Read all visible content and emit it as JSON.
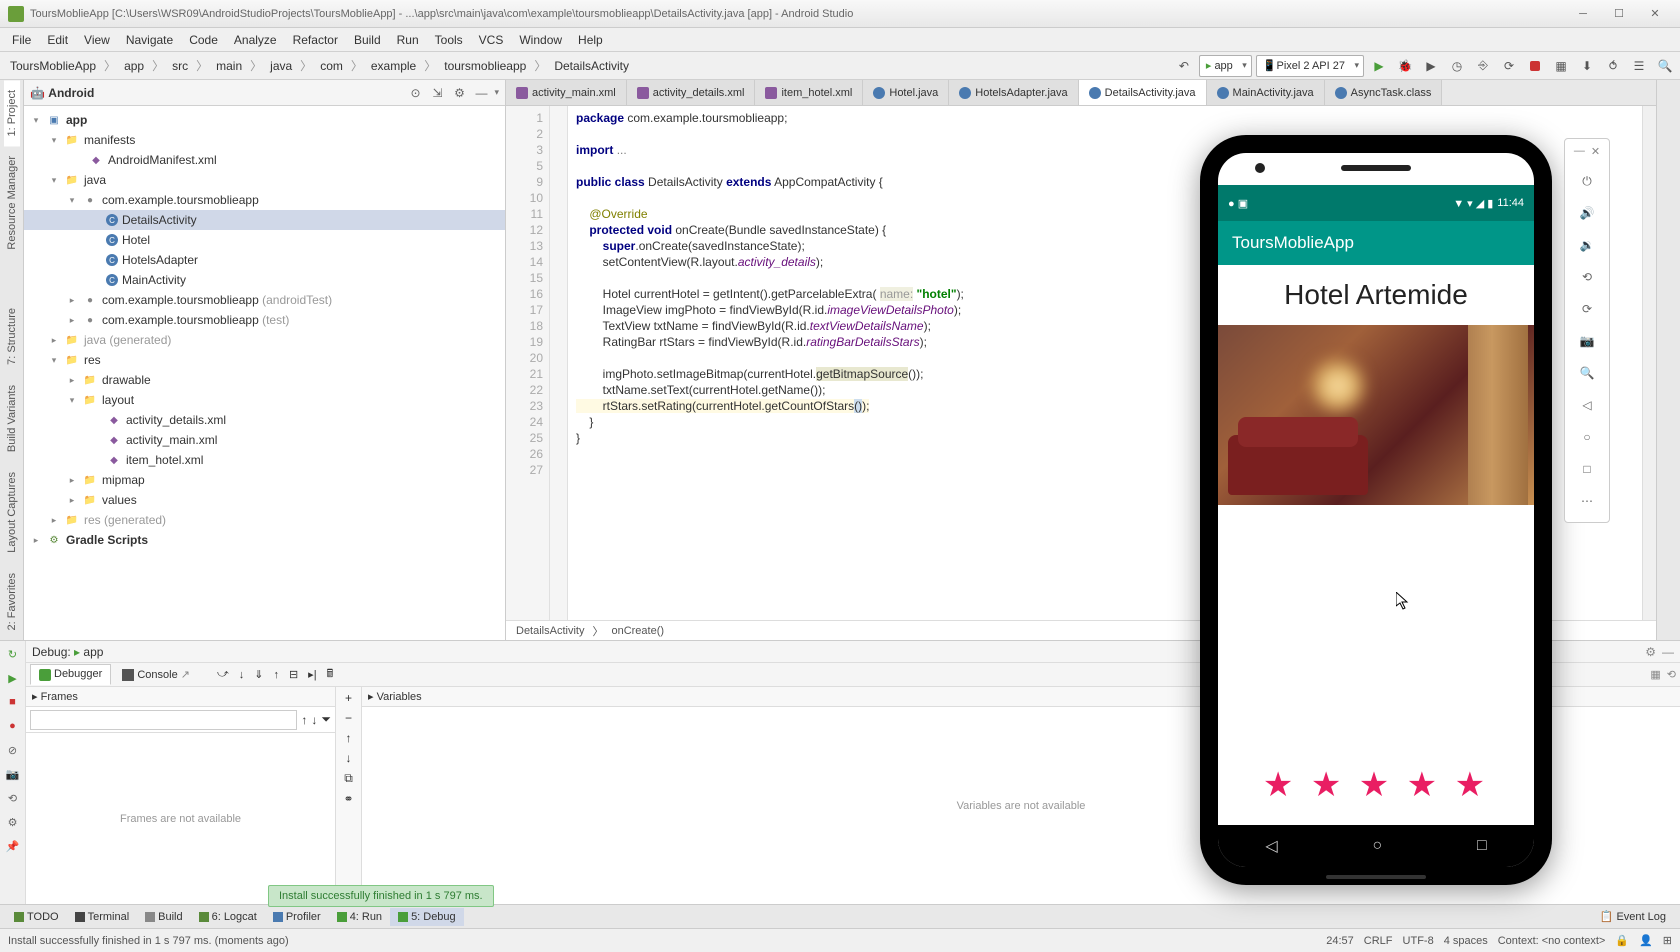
{
  "window": {
    "title": "ToursMoblieApp [C:\\Users\\WSR09\\AndroidStudioProjects\\ToursMoblieApp] - ...\\app\\src\\main\\java\\com\\example\\toursmoblieapp\\DetailsActivity.java [app] - Android Studio"
  },
  "menu": [
    "File",
    "Edit",
    "View",
    "Navigate",
    "Code",
    "Analyze",
    "Refactor",
    "Build",
    "Run",
    "Tools",
    "VCS",
    "Window",
    "Help"
  ],
  "breadcrumb": [
    "ToursMoblieApp",
    "app",
    "src",
    "main",
    "java",
    "com",
    "example",
    "toursmoblieapp",
    "DetailsActivity"
  ],
  "run_config": {
    "app": "app",
    "device": "Pixel 2 API 27"
  },
  "project_mode": "Android",
  "tree": {
    "root": "app",
    "manifests": {
      "label": "manifests",
      "child": "AndroidManifest.xml"
    },
    "java": {
      "label": "java",
      "pkg": "com.example.toursmoblieapp",
      "classes": [
        "DetailsActivity",
        "Hotel",
        "HotelsAdapter",
        "MainActivity"
      ],
      "pkg_test": "com.example.toursmoblieapp",
      "test_suffix": "(androidTest)",
      "pkg_unit": "com.example.toursmoblieapp",
      "unit_suffix": "(test)",
      "gen": "java",
      "gen_suffix": "(generated)"
    },
    "res": {
      "label": "res",
      "drawable": "drawable",
      "layout": "layout",
      "layouts": [
        "activity_details.xml",
        "activity_main.xml",
        "item_hotel.xml"
      ],
      "mipmap": "mipmap",
      "values": "values",
      "gen": "res",
      "gen_suffix": "(generated)"
    },
    "gradle": "Gradle Scripts"
  },
  "editor_tabs": [
    {
      "name": "activity_main.xml",
      "type": "xml"
    },
    {
      "name": "activity_details.xml",
      "type": "xml"
    },
    {
      "name": "item_hotel.xml",
      "type": "xml"
    },
    {
      "name": "Hotel.java",
      "type": "java"
    },
    {
      "name": "HotelsAdapter.java",
      "type": "java"
    },
    {
      "name": "DetailsActivity.java",
      "type": "java",
      "active": true
    },
    {
      "name": "MainActivity.java",
      "type": "java"
    },
    {
      "name": "AsyncTask.class",
      "type": "java"
    }
  ],
  "code": {
    "lines": [
      1,
      2,
      3,
      5,
      9,
      10,
      11,
      12,
      13,
      14,
      15,
      16,
      17,
      18,
      19,
      20,
      21,
      22,
      23,
      24,
      25,
      26,
      27
    ],
    "breadcrumb": [
      "DetailsActivity",
      "onCreate()"
    ]
  },
  "debug": {
    "title": "Debug:",
    "config": "app",
    "tabs": [
      "Debugger",
      "Console"
    ],
    "frames": {
      "title": "Frames",
      "empty": "Frames are not available"
    },
    "variables": {
      "title": "Variables",
      "empty": "Variables are not available"
    }
  },
  "bottom_tabs": [
    "TODO",
    "Terminal",
    "Build",
    "Logcat",
    "Profiler",
    "Run",
    "Debug"
  ],
  "event_log": "Event Log",
  "toast": "Install successfully finished in 1 s 797 ms.",
  "status": {
    "left": "Install successfully finished in 1 s 797 ms. (moments ago)",
    "pos": "24:57",
    "sep": "CRLF",
    "enc": "UTF-8",
    "indent": "4 spaces",
    "ctx": "Context: <no context>"
  },
  "emulator": {
    "time": "11:44",
    "app_name": "ToursMoblieApp",
    "hotel_name": "Hotel Artemide",
    "stars": "★ ★ ★ ★ ★"
  }
}
